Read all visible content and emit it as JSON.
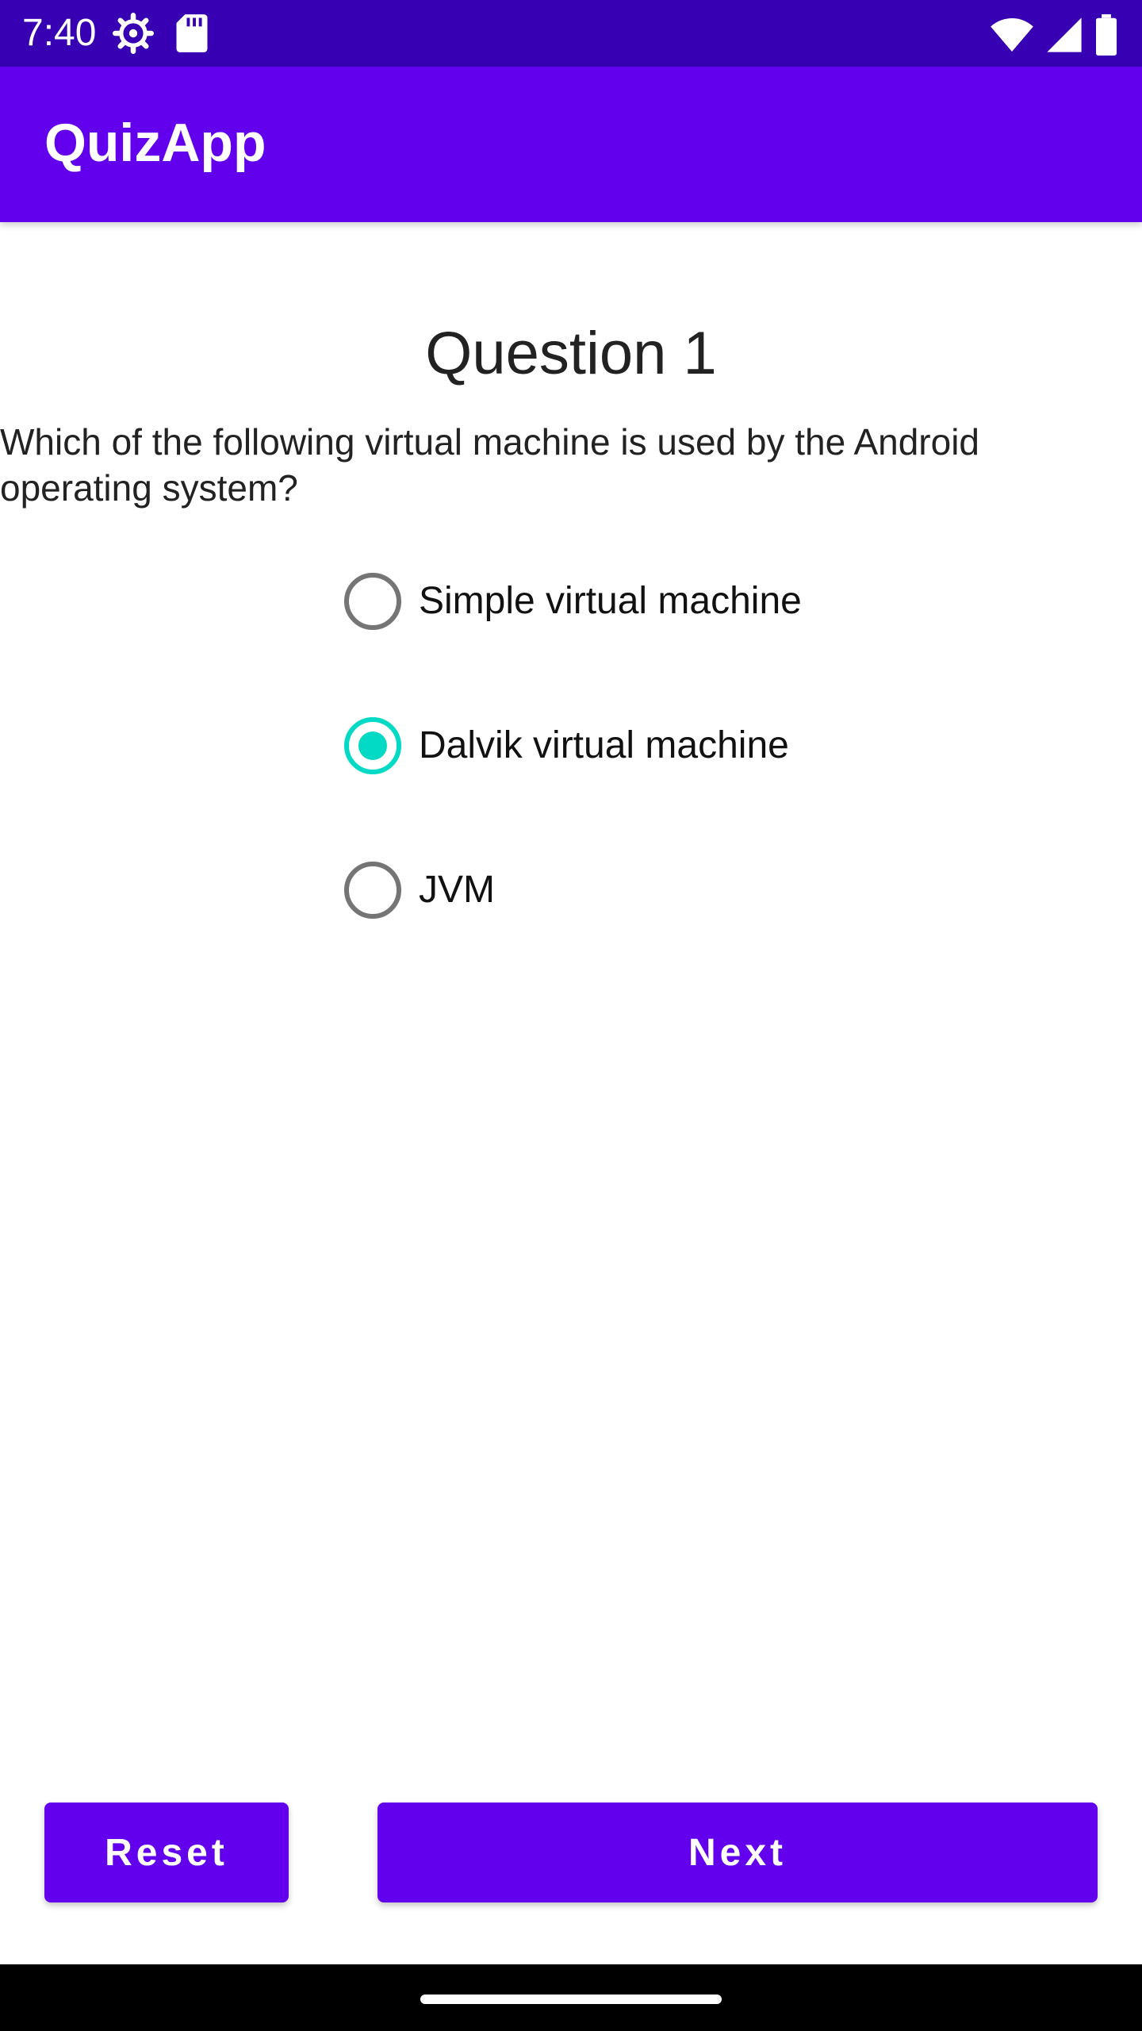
{
  "status_bar": {
    "time": "7:40",
    "left_icons": [
      "settings-gear-icon",
      "sd-card-icon"
    ],
    "right_icons": [
      "wifi-icon",
      "cellular-signal-icon",
      "battery-icon"
    ]
  },
  "app_bar": {
    "title": "QuizApp"
  },
  "quiz": {
    "question_title": "Question 1",
    "question_text": "Which of the following virtual machine is used by the Android operating system?",
    "options": [
      {
        "label": "Simple virtual machine",
        "selected": false
      },
      {
        "label": "Dalvik virtual machine",
        "selected": true
      },
      {
        "label": "JVM",
        "selected": false
      }
    ]
  },
  "buttons": {
    "reset_label": "Reset",
    "next_label": "Next"
  },
  "colors": {
    "primary": "#6200EE",
    "primary_dark": "#3700B3",
    "accent": "#03DAC5",
    "radio_unchecked": "#757575"
  }
}
